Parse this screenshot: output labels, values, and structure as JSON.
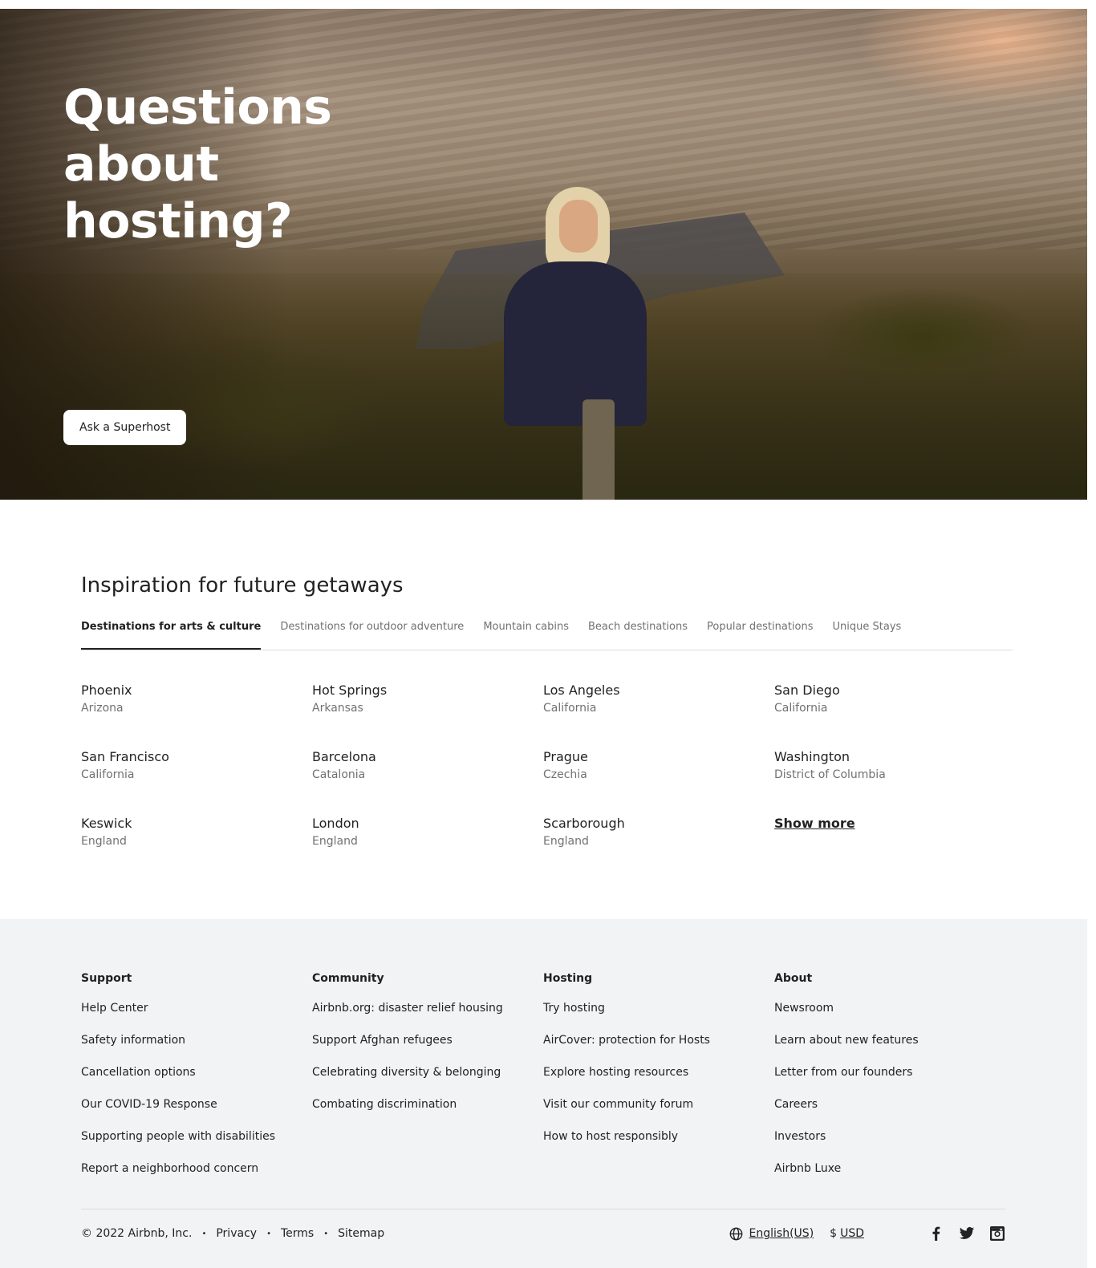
{
  "hero": {
    "title": "Questions\nabout\nhosting?",
    "cta_label": "Ask a Superhost"
  },
  "inspiration": {
    "title": "Inspiration for future getaways",
    "tabs": [
      {
        "label": "Destinations for arts & culture",
        "active": true
      },
      {
        "label": "Destinations for outdoor adventure",
        "active": false
      },
      {
        "label": "Mountain cabins",
        "active": false
      },
      {
        "label": "Beach destinations",
        "active": false
      },
      {
        "label": "Popular destinations",
        "active": false
      },
      {
        "label": "Unique Stays",
        "active": false
      }
    ],
    "destinations": [
      {
        "city": "Phoenix",
        "region": "Arizona"
      },
      {
        "city": "Hot Springs",
        "region": "Arkansas"
      },
      {
        "city": "Los Angeles",
        "region": "California"
      },
      {
        "city": "San Diego",
        "region": "California"
      },
      {
        "city": "San Francisco",
        "region": "California"
      },
      {
        "city": "Barcelona",
        "region": "Catalonia"
      },
      {
        "city": "Prague",
        "region": "Czechia"
      },
      {
        "city": "Washington",
        "region": "District of Columbia"
      },
      {
        "city": "Keswick",
        "region": "England"
      },
      {
        "city": "London",
        "region": "England"
      },
      {
        "city": "Scarborough",
        "region": "England"
      }
    ],
    "show_more_label": "Show more"
  },
  "footer": {
    "columns": [
      {
        "heading": "Support",
        "links": [
          "Help Center",
          "Safety information",
          "Cancellation options",
          "Our COVID-19 Response",
          "Supporting people with disabilities",
          "Report a neighborhood concern"
        ]
      },
      {
        "heading": "Community",
        "links": [
          "Airbnb.org: disaster relief housing",
          "Support Afghan refugees",
          "Celebrating diversity & belonging",
          "Combating discrimination"
        ]
      },
      {
        "heading": "Hosting",
        "links": [
          "Try hosting",
          "AirCover: protection for Hosts",
          "Explore hosting resources",
          "Visit our community forum",
          "How to host responsibly"
        ]
      },
      {
        "heading": "About",
        "links": [
          "Newsroom",
          "Learn about new features",
          "Letter from our founders",
          "Careers",
          "Investors",
          "Airbnb Luxe"
        ]
      }
    ],
    "copyright": "© 2022 Airbnb, Inc.",
    "separator": "•",
    "legal_links": [
      "Privacy",
      "Terms",
      "Sitemap"
    ],
    "language": "English(US)",
    "currency_symbol": "$",
    "currency": "USD",
    "social_icons": [
      "facebook-icon",
      "twitter-icon",
      "instagram-icon"
    ]
  },
  "colors": {
    "text_primary": "#222222",
    "text_secondary": "#717171",
    "footer_bg": "#f2f3f5",
    "divider": "#dddddd"
  }
}
